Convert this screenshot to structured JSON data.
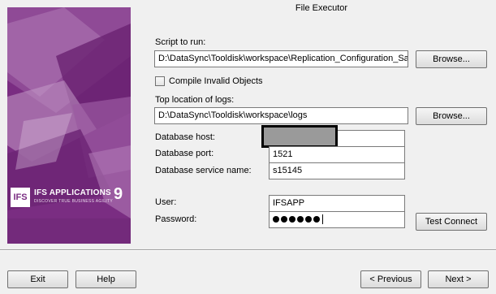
{
  "window": {
    "title": "File Executor"
  },
  "banner": {
    "logo_mark": "IFS",
    "product": "IFS APPLICATIONS",
    "version": "9",
    "tagline": "DISCOVER TRUE BUSINESS AGILITY"
  },
  "form": {
    "script_label": "Script to run:",
    "script_value": "D:\\DataSync\\Tooldisk\\workspace\\Replication_Configuration_Sa",
    "browse_label": "Browse...",
    "compile_label": "Compile Invalid Objects",
    "compile_checked": false,
    "logs_label": "Top location of logs:",
    "logs_value": "D:\\DataSync\\Tooldisk\\workspace\\logs",
    "browse2_label": "Browse...",
    "db_host_label": "Database host:",
    "db_host_value": "",
    "db_port_label": "Database port:",
    "db_port_value": "1521",
    "db_service_label": "Database service name:",
    "db_service_value": "s15145",
    "user_label": "User:",
    "user_value": "IFSAPP",
    "password_label": "Password:",
    "password_length": 6,
    "test_connect_label": "Test Connect"
  },
  "footer": {
    "exit_label": "Exit",
    "help_label": "Help",
    "previous_label": "< Previous",
    "next_label": "Next >"
  },
  "colors": {
    "banner": "#7a2d82",
    "redaction": "#9a9a9a"
  }
}
